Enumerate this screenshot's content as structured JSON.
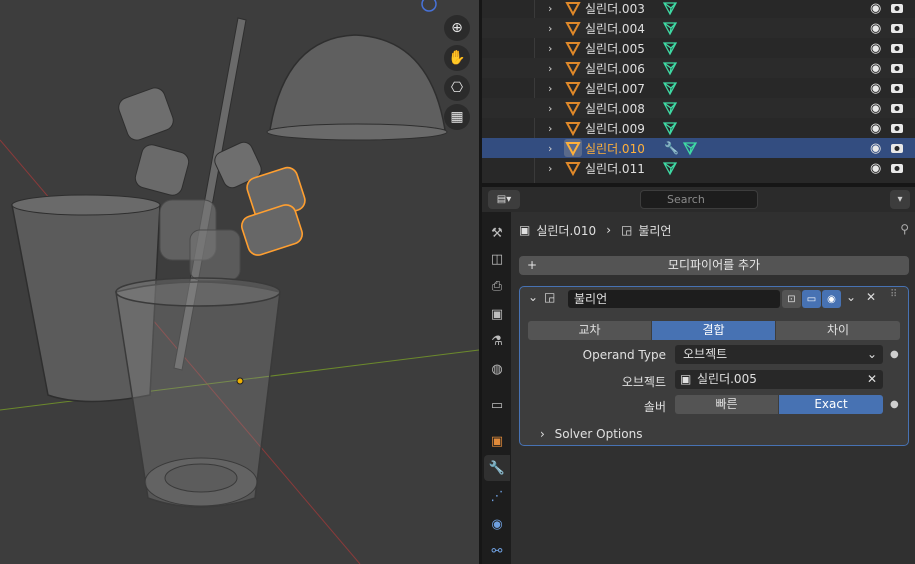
{
  "viewport": {
    "nav_icons": [
      "zoom-icon",
      "hand-icon",
      "camera-icon",
      "grid-icon"
    ]
  },
  "outliner": {
    "rows": [
      {
        "name": "실린더.003",
        "selected": false
      },
      {
        "name": "실린더.004",
        "selected": false
      },
      {
        "name": "실린더.005",
        "selected": false
      },
      {
        "name": "실린더.006",
        "selected": false
      },
      {
        "name": "실린더.007",
        "selected": false
      },
      {
        "name": "실린더.008",
        "selected": false
      },
      {
        "name": "실린더.009",
        "selected": false
      },
      {
        "name": "실린더.010",
        "selected": true
      },
      {
        "name": "실린더.011",
        "selected": false
      }
    ]
  },
  "properties": {
    "search_placeholder": "Search",
    "breadcrumb": {
      "object": "실린더.010",
      "modifier": "불리언"
    },
    "add_modifier_label": "모디파이어를 추가",
    "modifier": {
      "name": "불리언",
      "operations": [
        "교차",
        "결합",
        "차이"
      ],
      "active_operation": "결합",
      "operand_type_label": "Operand Type",
      "operand_type_value": "오브젝트",
      "object_label": "오브젝트",
      "object_value": "실린더.005",
      "solver_label": "솔버",
      "solver_options": [
        "빠른",
        "Exact"
      ],
      "active_solver": "Exact",
      "solver_options_label": "Solver Options"
    }
  },
  "colors": {
    "accent": "#4772b3",
    "selection_orange": "#ffb13b",
    "mesh_green": "#3fd9a4"
  }
}
